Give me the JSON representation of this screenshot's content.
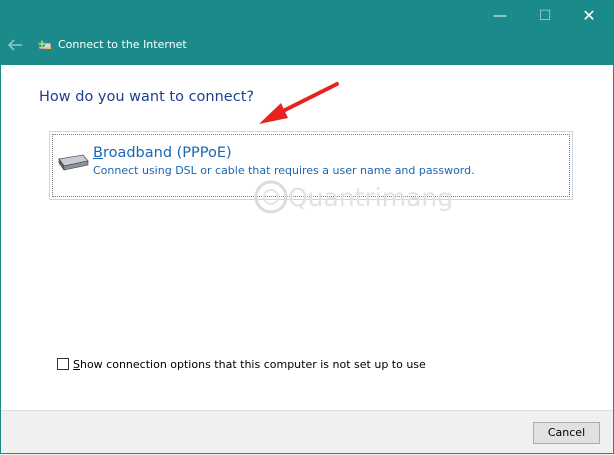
{
  "window": {
    "title": "Connect to the Internet",
    "accent_color": "#1b8a8a",
    "controls": {
      "minimize": "minimize-icon",
      "maximize": "maximize-icon",
      "close": "close-icon"
    }
  },
  "main": {
    "heading": "How do you want to connect?",
    "option": {
      "title_underlined": "B",
      "title_rest": "roadband (PPPoE)",
      "description": "Connect using DSL or cable that requires a user name and password.",
      "icon": "modem-icon"
    },
    "checkbox": {
      "label_underlined": "S",
      "label_rest": "how connection options that this computer is not set up to use",
      "checked": false
    }
  },
  "watermark": {
    "text": "Quantrimang"
  },
  "footer": {
    "cancel_label": "Cancel"
  }
}
